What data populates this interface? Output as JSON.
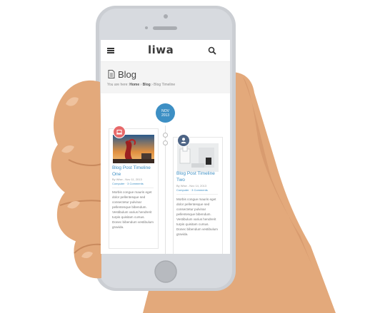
{
  "header": {
    "logo": "liwa"
  },
  "page": {
    "title": "Blog",
    "breadcrumb_prefix": "You are here:",
    "breadcrumb_home": "Home",
    "breadcrumb_sep": "›",
    "breadcrumb_blog": "Blog",
    "breadcrumb_current": "Blog Timeline"
  },
  "timeline": {
    "month": "NOV",
    "year": "2013"
  },
  "posts": [
    {
      "title": "Blog Post Timeline One",
      "meta": "By Wise - Nov 11, 2013",
      "category": "Computer",
      "comments": "3 Comments",
      "excerpt": "Morbis congue mauris eget dolor pellentesque sed consectetur pulvinar pellentesque bibendum. Vestibulum varius hendrerit turpis quisitam cursus. Donec bibendum vestibulum gravida.",
      "badge_color": "#e7696a"
    },
    {
      "title": "Blog Post Timeline Two",
      "meta": "By Wise - Nov 14, 2013",
      "category": "Computer",
      "comments": "3 Comments",
      "excerpt": "Morbis congue mauris eget dolor pellentesque sed consectetur pulvinar pellentesque bibendum. Vestibulum varius hendrerit turpis quisitam cursus. Donec bibendum vestibulum gravida.",
      "badge_color": "#4d6485"
    }
  ],
  "colors": {
    "accent": "#3d8fc4",
    "skin": "#e3a97b",
    "phone_body": "#cbced3"
  }
}
